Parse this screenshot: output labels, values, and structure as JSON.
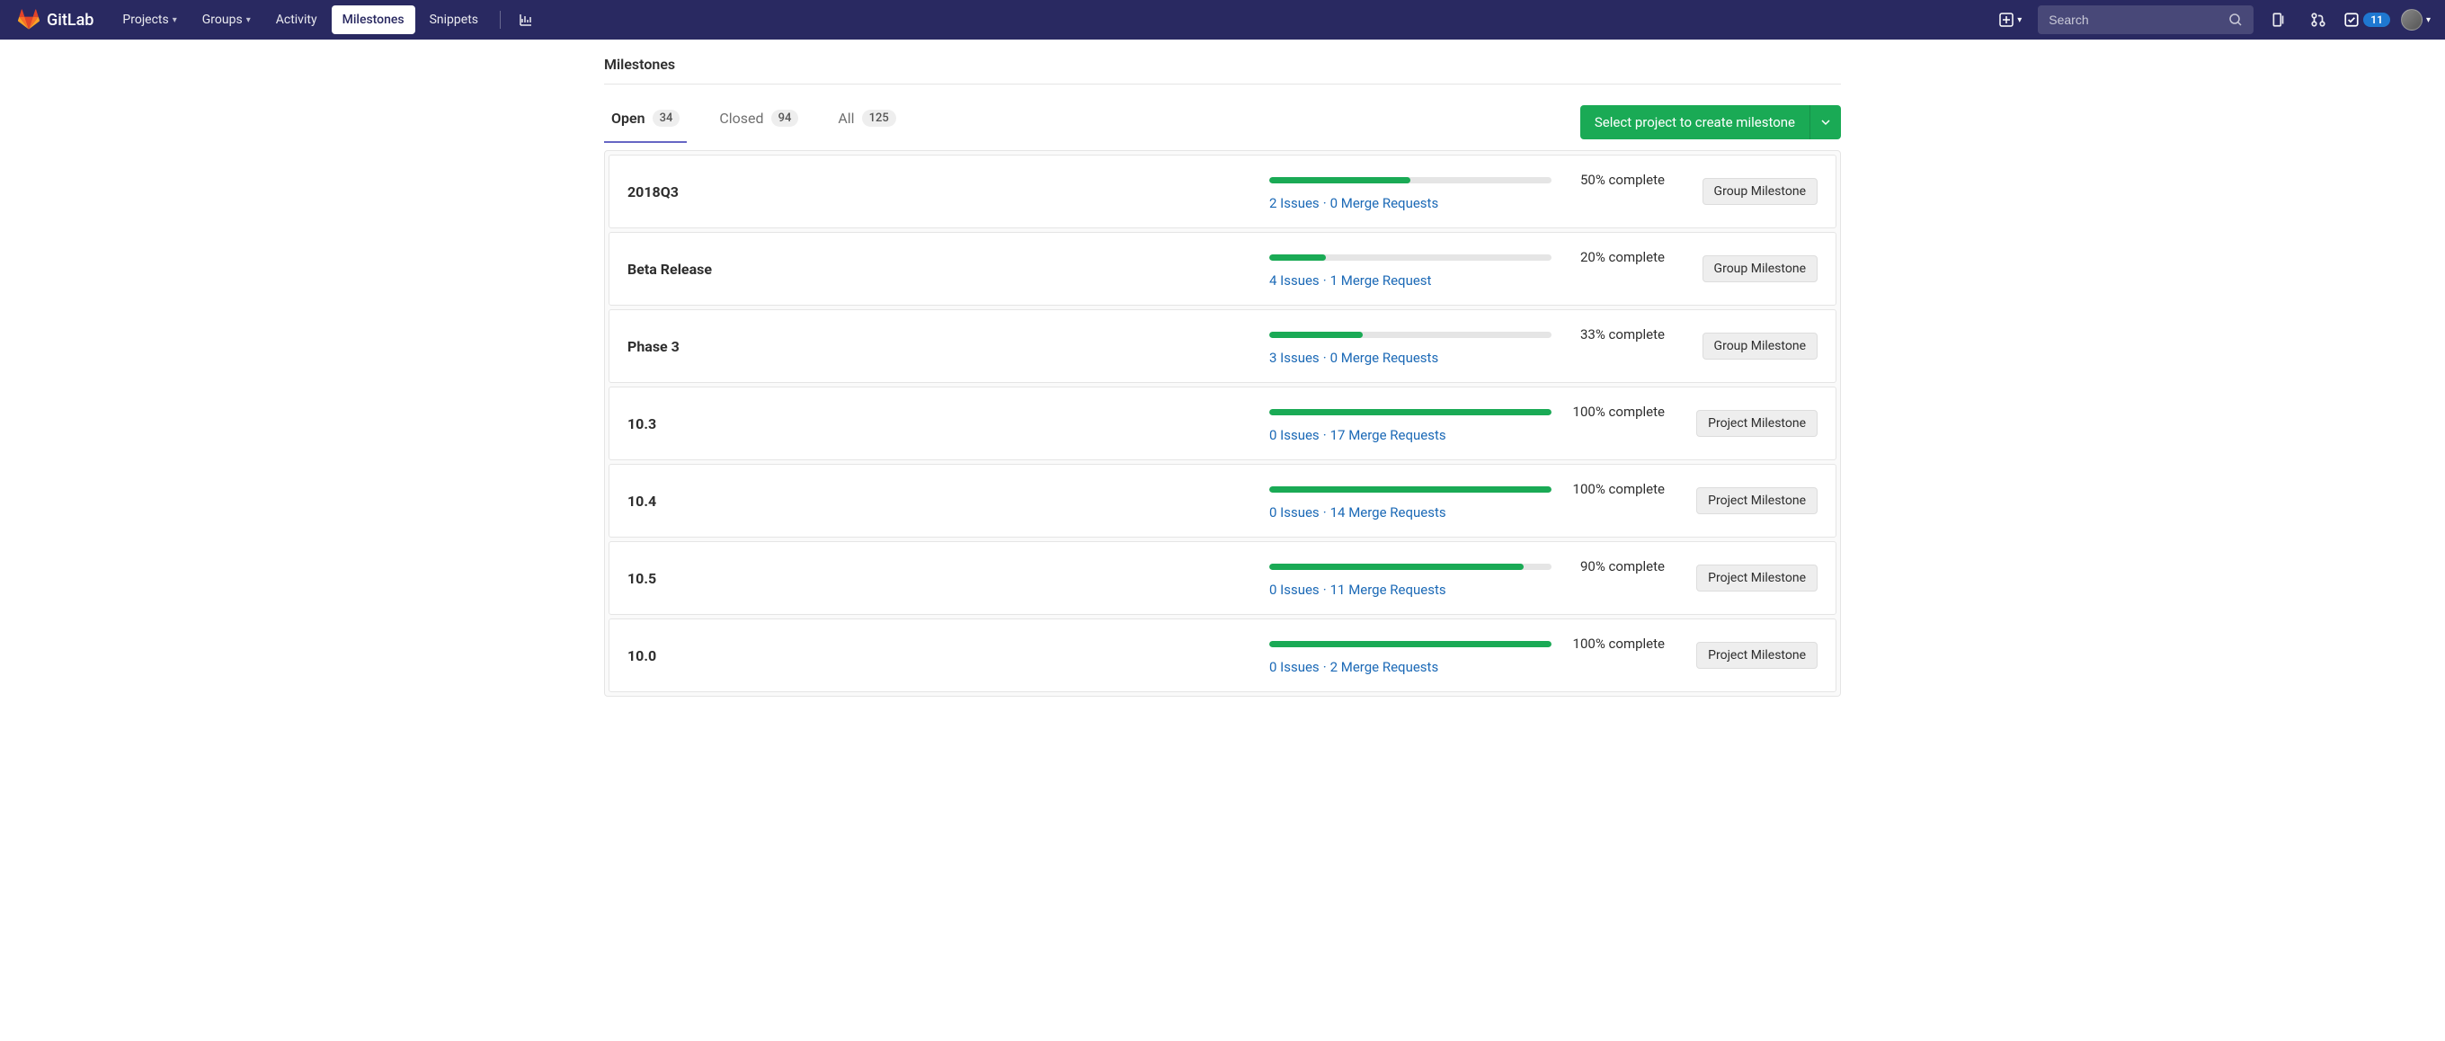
{
  "brand": "GitLab",
  "nav": {
    "projects": "Projects",
    "groups": "Groups",
    "activity": "Activity",
    "milestones": "Milestones",
    "snippets": "Snippets"
  },
  "search": {
    "placeholder": "Search"
  },
  "todos_count": "11",
  "page_title": "Milestones",
  "tabs": {
    "open": {
      "label": "Open",
      "count": "34"
    },
    "closed": {
      "label": "Closed",
      "count": "94"
    },
    "all": {
      "label": "All",
      "count": "125"
    }
  },
  "create_button": "Select project to create milestone",
  "milestones": [
    {
      "title": "2018Q3",
      "issues": "2 Issues",
      "mrs": "0 Merge Requests",
      "pct": 50,
      "pct_label": "50% complete",
      "type": "Group Milestone"
    },
    {
      "title": "Beta Release",
      "issues": "4 Issues",
      "mrs": "1 Merge Request",
      "pct": 20,
      "pct_label": "20% complete",
      "type": "Group Milestone"
    },
    {
      "title": "Phase 3",
      "issues": "3 Issues",
      "mrs": "0 Merge Requests",
      "pct": 33,
      "pct_label": "33% complete",
      "type": "Group Milestone"
    },
    {
      "title": "10.3",
      "issues": "0 Issues",
      "mrs": "17 Merge Requests",
      "pct": 100,
      "pct_label": "100% complete",
      "type": "Project Milestone"
    },
    {
      "title": "10.4",
      "issues": "0 Issues",
      "mrs": "14 Merge Requests",
      "pct": 100,
      "pct_label": "100% complete",
      "type": "Project Milestone"
    },
    {
      "title": "10.5",
      "issues": "0 Issues",
      "mrs": "11 Merge Requests",
      "pct": 90,
      "pct_label": "90% complete",
      "type": "Project Milestone"
    },
    {
      "title": "10.0",
      "issues": "0 Issues",
      "mrs": "2 Merge Requests",
      "pct": 100,
      "pct_label": "100% complete",
      "type": "Project Milestone"
    }
  ]
}
